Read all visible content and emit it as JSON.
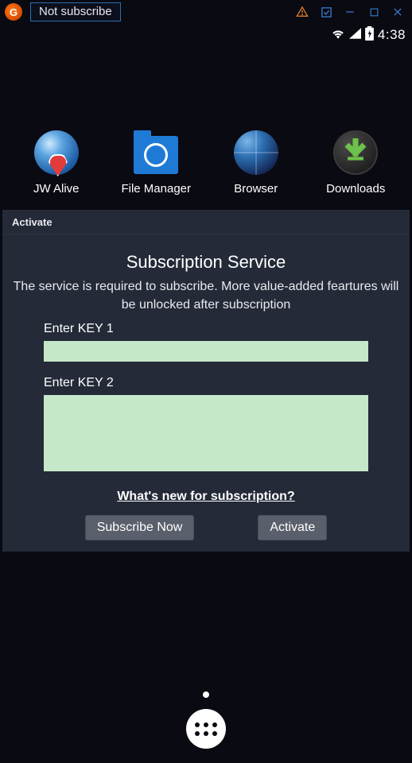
{
  "titlebar": {
    "badge_text": "Not subscribe"
  },
  "statusbar": {
    "time": "4:38"
  },
  "apps": [
    {
      "label": "JW Alive"
    },
    {
      "label": "File Manager"
    },
    {
      "label": "Browser"
    },
    {
      "label": "Downloads"
    }
  ],
  "panel": {
    "tab_label": "Activate",
    "title": "Subscription Service",
    "description": "The service is required to subscribe. More value-added feartures will be unlocked after subscription",
    "key1_label": "Enter KEY 1",
    "key1_value": "",
    "key2_label": "Enter KEY 2",
    "key2_value": "",
    "link_text": "What's new for subscription?",
    "subscribe_label": "Subscribe Now",
    "activate_label": "Activate"
  }
}
